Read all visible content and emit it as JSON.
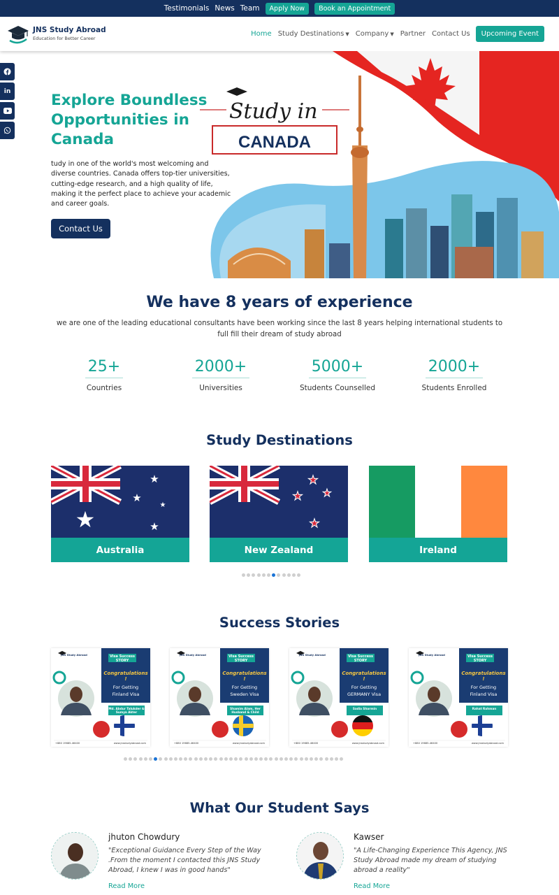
{
  "topbar": {
    "links": [
      "Testimonials",
      "News",
      "Team"
    ],
    "apply_label": "Apply Now",
    "appointment_label": "Book an Appointment"
  },
  "brand": {
    "name": "JNS Study Abroad",
    "tagline": "Education for Better Career"
  },
  "nav": {
    "home": "Home",
    "destinations": "Study Destinations",
    "company": "Company",
    "partner": "Partner",
    "contact": "Contact Us",
    "upcoming": "Upcoming Event"
  },
  "social": {
    "icons": [
      "facebook-icon",
      "linkedin-icon",
      "youtube-icon",
      "whatsapp-icon"
    ]
  },
  "hero": {
    "title": "Explore Boundless Opportunities in Canada",
    "text": "tudy in one of the world's most welcoming and diverse countries. Canada offers top-tier universities, cutting-edge research, and a high quality of life, making it the perfect place to achieve your academic and career goals.",
    "button": "Contact Us",
    "banner_script": "Study in",
    "banner_country": "CANADA"
  },
  "experience": {
    "title": "We have 8 years of experience",
    "text": "we are one of the leading educational consultants have been working since the last 8 years helping international students to full fill their dream of study abroad",
    "stats": [
      {
        "value": "25+",
        "label": "Countries"
      },
      {
        "value": "2000+",
        "label": "Universities"
      },
      {
        "value": "5000+",
        "label": "Students Counselled"
      },
      {
        "value": "2000+",
        "label": "Students Enrolled"
      }
    ]
  },
  "destinations": {
    "title": "Study Destinations",
    "cards": [
      {
        "name": "Australia"
      },
      {
        "name": "New Zealand"
      },
      {
        "name": "Ireland"
      }
    ],
    "dot_count": 12,
    "active_dot": 6
  },
  "stories": {
    "title": "Success Stories",
    "cards": [
      {
        "badge": "Visa Success STORY",
        "headline": "Congratulations !",
        "line1": "For Getting",
        "country": "Finland",
        "suffix": "Visa",
        "names": "Md. Abdur Talukder & Sumya Akter"
      },
      {
        "badge": "Visa Success STORY",
        "headline": "Congratulations !",
        "line1": "For Getting",
        "country": "Sweden",
        "suffix": "Visa",
        "names": "Shamim Alam, Her Husband & Child"
      },
      {
        "badge": "Visa Success STORY",
        "headline": "Congratulations !",
        "line1": "For Getting",
        "country": "GERMANY",
        "suffix": "Visa",
        "names": "Sadia Sharmin"
      },
      {
        "badge": "Visa Success STORY",
        "headline": "Congratulations !",
        "line1": "For Getting",
        "country": "Finland",
        "suffix": "Visa",
        "names": "Rahat Rahman"
      }
    ],
    "card_phone": "+880 19685-46400",
    "card_site": "www.jnsstudyabroad.com",
    "dot_count": 44,
    "active_dot": 6
  },
  "testimonials": {
    "title": "What Our Student Says",
    "items": [
      {
        "name": "jhuton Chowdury",
        "quote": "\"Exceptional Guidance Every Step of the Way .From the moment I contacted this JNS Study Abroad, I knew I was in good hands\"",
        "more": "Read More"
      },
      {
        "name": "Kawser",
        "quote": "\"A Life-Changing Experience This Agency, JNS Study Abroad made my dream of studying abroad a reality\"",
        "more": "Read More"
      }
    ]
  }
}
